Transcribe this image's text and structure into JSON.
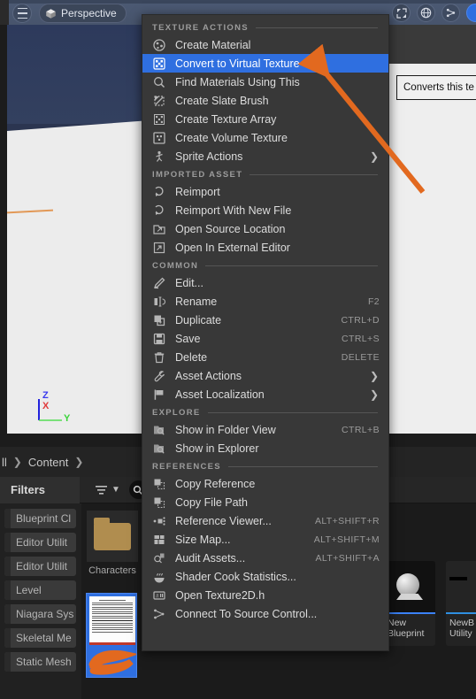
{
  "viewport": {
    "menu_icon": "hamburger-icon",
    "perspective_label": "Perspective",
    "perspective_icon": "cube-icon",
    "toolbar_icons": [
      "expand-icon",
      "globe-icon",
      "snap-icon"
    ],
    "gizmo": {
      "z": "Z",
      "x": "X",
      "y": "Y"
    }
  },
  "tooltip": {
    "text": "Converts this te"
  },
  "context_menu": {
    "sections": [
      {
        "title": "TEXTURE ACTIONS",
        "items": [
          {
            "label": "Create Material",
            "icon": "material-sphere-icon",
            "shortcut": "",
            "submenu": false,
            "selected": false
          },
          {
            "label": "Convert to Virtual Texture",
            "icon": "virtual-texture-icon",
            "shortcut": "",
            "submenu": false,
            "selected": true
          },
          {
            "label": "Find Materials Using This",
            "icon": "magnifier-icon",
            "shortcut": "",
            "submenu": false,
            "selected": false
          },
          {
            "label": "Create Slate Brush",
            "icon": "slate-brush-icon",
            "shortcut": "",
            "submenu": false,
            "selected": false
          },
          {
            "label": "Create Texture Array",
            "icon": "texture-array-icon",
            "shortcut": "",
            "submenu": false,
            "selected": false
          },
          {
            "label": "Create Volume Texture",
            "icon": "volume-texture-icon",
            "shortcut": "",
            "submenu": false,
            "selected": false
          },
          {
            "label": "Sprite Actions",
            "icon": "sprite-icon",
            "shortcut": "",
            "submenu": true,
            "selected": false
          }
        ]
      },
      {
        "title": "IMPORTED ASSET",
        "items": [
          {
            "label": "Reimport",
            "icon": "reimport-icon",
            "shortcut": "",
            "submenu": false,
            "selected": false
          },
          {
            "label": "Reimport With New File",
            "icon": "reimport-new-icon",
            "shortcut": "",
            "submenu": false,
            "selected": false
          },
          {
            "label": "Open Source Location",
            "icon": "folder-open-icon",
            "shortcut": "",
            "submenu": false,
            "selected": false
          },
          {
            "label": "Open In External Editor",
            "icon": "external-editor-icon",
            "shortcut": "",
            "submenu": false,
            "selected": false
          }
        ]
      },
      {
        "title": "COMMON",
        "items": [
          {
            "label": "Edit...",
            "icon": "pencil-icon",
            "shortcut": "",
            "submenu": false,
            "selected": false
          },
          {
            "label": "Rename",
            "icon": "rename-icon",
            "shortcut": "F2",
            "submenu": false,
            "selected": false
          },
          {
            "label": "Duplicate",
            "icon": "duplicate-icon",
            "shortcut": "CTRL+D",
            "submenu": false,
            "selected": false
          },
          {
            "label": "Save",
            "icon": "save-disk-icon",
            "shortcut": "CTRL+S",
            "submenu": false,
            "selected": false
          },
          {
            "label": "Delete",
            "icon": "trash-icon",
            "shortcut": "DELETE",
            "submenu": false,
            "selected": false
          },
          {
            "label": "Asset Actions",
            "icon": "wrench-icon",
            "shortcut": "",
            "submenu": true,
            "selected": false
          },
          {
            "label": "Asset Localization",
            "icon": "flag-icon",
            "shortcut": "",
            "submenu": true,
            "selected": false
          }
        ]
      },
      {
        "title": "EXPLORE",
        "items": [
          {
            "label": "Show in Folder View",
            "icon": "folder-search-icon",
            "shortcut": "CTRL+B",
            "submenu": false,
            "selected": false
          },
          {
            "label": "Show in Explorer",
            "icon": "folder-search-icon",
            "shortcut": "",
            "submenu": false,
            "selected": false
          }
        ]
      },
      {
        "title": "REFERENCES",
        "items": [
          {
            "label": "Copy Reference",
            "icon": "copy-reference-icon",
            "shortcut": "",
            "submenu": false,
            "selected": false
          },
          {
            "label": "Copy File Path",
            "icon": "copy-path-icon",
            "shortcut": "",
            "submenu": false,
            "selected": false
          },
          {
            "label": "Reference Viewer...",
            "icon": "reference-viewer-icon",
            "shortcut": "ALT+SHIFT+R",
            "submenu": false,
            "selected": false
          },
          {
            "label": "Size Map...",
            "icon": "size-map-icon",
            "shortcut": "ALT+SHIFT+M",
            "submenu": false,
            "selected": false
          },
          {
            "label": "Audit Assets...",
            "icon": "audit-icon",
            "shortcut": "ALT+SHIFT+A",
            "submenu": false,
            "selected": false
          },
          {
            "label": "Shader Cook Statistics...",
            "icon": "shader-cook-icon",
            "shortcut": "",
            "submenu": false,
            "selected": false
          },
          {
            "label": "Open Texture2D.h",
            "icon": "header-file-icon",
            "shortcut": "",
            "submenu": false,
            "selected": false
          },
          {
            "label": "Connect To Source Control...",
            "icon": "source-control-icon",
            "shortcut": "",
            "submenu": false,
            "selected": false
          }
        ]
      }
    ]
  },
  "content_browser": {
    "breadcrumb": [
      "ll",
      "Content"
    ],
    "filters_label": "Filters",
    "filter_icon": "filter-icon",
    "chevron_icon": "chevron-down-icon",
    "search_icon": "search-icon",
    "filter_chips": [
      "Blueprint Cl",
      "Editor Utilit",
      "Editor Utilit",
      "Level",
      "Niagara Sys",
      "Skeletal Me",
      "Static Mesh"
    ],
    "assets": [
      {
        "name": "Characters",
        "type": "folder"
      },
      {
        "name": "",
        "type": "texture-selected"
      },
      {
        "name": "New\nBlueprint",
        "type": "blueprint"
      },
      {
        "name": "NewB\nUtility",
        "type": "blueprint"
      }
    ],
    "blueprint_1_line1": "New",
    "blueprint_1_line2": "Blueprint",
    "blueprint_2_line1": "NewB",
    "blueprint_2_line2": "Utility"
  },
  "colors": {
    "accent_blue": "#2f6fe0",
    "annotation_orange": "#e2691f",
    "menu_bg": "#383838",
    "folder_gold": "#b08d4f"
  }
}
